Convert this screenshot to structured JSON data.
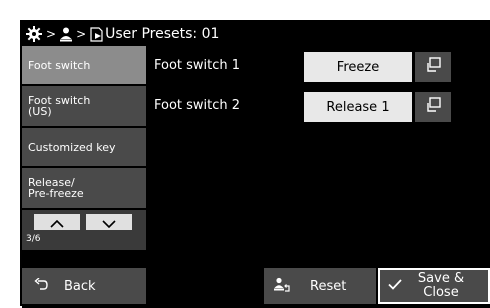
{
  "titlebar": {
    "title": "User Presets: 01",
    "icons": [
      "gear-icon",
      "user-icon",
      "document-icon"
    ],
    "separator": ">"
  },
  "sidebar": {
    "items": [
      {
        "label": "Foot switch",
        "active": true
      },
      {
        "label": "Foot switch (US)",
        "active": false
      },
      {
        "label": "Customized key",
        "active": false
      },
      {
        "label": "Release/ Pre-freeze",
        "active": false
      }
    ],
    "page_indicator": "3/6"
  },
  "rows": [
    {
      "label": "Foot switch 1",
      "value": "Freeze"
    },
    {
      "label": "Foot switch 2",
      "value": "Release 1"
    }
  ],
  "bottom": {
    "back_label": "Back",
    "reset_label": "Reset",
    "save_label": "Save & Close"
  },
  "colors": {
    "background": "#000000",
    "active_item": "#8c8c8c",
    "button": "#4a4a4a",
    "value_button": "#e8e8e8"
  }
}
